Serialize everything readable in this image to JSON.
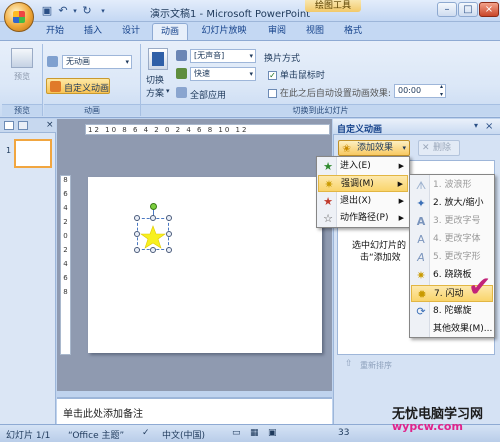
{
  "title_bar": {
    "title": "演示文稿1 - Microsoft PowerPoint",
    "context_label": "绘图工具",
    "qat_icons": [
      "save-icon",
      "undo-icon",
      "redo-icon",
      "customize-icon"
    ]
  },
  "tabs": [
    {
      "label": "开始"
    },
    {
      "label": "插入"
    },
    {
      "label": "设计"
    },
    {
      "label": "动画"
    },
    {
      "label": "幻灯片放映"
    },
    {
      "label": "审阅"
    },
    {
      "label": "视图"
    },
    {
      "label": "格式"
    }
  ],
  "active_tab": "动画",
  "ribbon": {
    "preview": {
      "button": "预览",
      "group": "预览"
    },
    "animations": {
      "dropdown_value": "无动画",
      "custom_button": "自定义动画",
      "group": "动画"
    },
    "transition": {
      "switch_label_1": "切换",
      "switch_label_2": "方案",
      "sound_value": "[无声音]",
      "speed_value": "快速",
      "apply_all": "全部应用",
      "advance_title": "换片方式",
      "on_click": "单击鼠标时",
      "auto_after": "在此之后自动设置动画效果:",
      "auto_time": "00:00",
      "group": "切换到此幻灯片"
    }
  },
  "slide_pane": {
    "slide_number": "1"
  },
  "ruler": {
    "h_marks": "12  10  8  6  4  2  0  2  4  6  8  10  12",
    "v_marks": [
      "8",
      "6",
      "4",
      "2",
      "0",
      "2",
      "4",
      "6",
      "8"
    ]
  },
  "notes": {
    "placeholder": "单击此处添加备注"
  },
  "task_pane": {
    "title": "自定义动画",
    "add_effect": "添加效果",
    "remove": "删除",
    "hint_line1": "选中幻灯片的",
    "hint_line2": "击“添加效",
    "reorder": "重新排序"
  },
  "menu_effect_types": [
    {
      "label": "进入(E)",
      "icon": "entrance-star-icon",
      "highlight": false
    },
    {
      "label": "强调(M)",
      "icon": "emphasis-star-icon",
      "highlight": true
    },
    {
      "label": "退出(X)",
      "icon": "exit-star-icon",
      "highlight": false
    },
    {
      "label": "动作路径(P)",
      "icon": "motion-path-icon",
      "highlight": false
    }
  ],
  "menu_emphasis": [
    {
      "label": "1. 波浪形",
      "icon": "wave-icon",
      "disabled": true
    },
    {
      "label": "2. 放大/缩小",
      "icon": "grow-shrink-icon",
      "disabled": false
    },
    {
      "label": "3. 更改字号",
      "icon": "font-size-icon",
      "disabled": true
    },
    {
      "label": "4. 更改字体",
      "icon": "font-icon",
      "disabled": true
    },
    {
      "label": "5. 更改字形",
      "icon": "font-style-icon",
      "disabled": true
    },
    {
      "label": "6. 跷跷板",
      "icon": "teeter-icon",
      "disabled": false
    },
    {
      "label": "7. 闪动",
      "icon": "flicker-icon",
      "disabled": false,
      "highlight": true
    },
    {
      "label": "8. 陀螺旋",
      "icon": "spin-icon",
      "disabled": false
    },
    {
      "label": "其他效果(M)...",
      "icon": "",
      "disabled": false
    }
  ],
  "status_bar": {
    "slide_info": "幻灯片 1/1",
    "theme": "“Office 主题”",
    "language": "中文(中国)",
    "zoom": "33"
  },
  "watermark": {
    "line1": "无忧电脑学习网",
    "line2": "wypcw.com"
  },
  "colors": {
    "accent": "#f9c455",
    "ribbon_bg": "#dbe7f7",
    "highlight_check": "#c2247a"
  }
}
